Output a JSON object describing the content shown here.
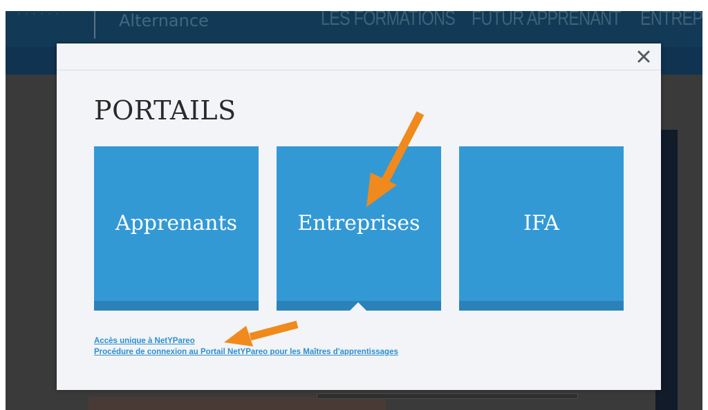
{
  "background_page": {
    "brand_small": "· · · · · ·",
    "brand": "Alternance",
    "nav": [
      "LES FORMATIONS",
      "FUTUR APPRENANT",
      "ENTREPRI"
    ]
  },
  "modal": {
    "title": "PORTAILS",
    "close_icon": "close-icon",
    "tiles": [
      {
        "label": "Apprenants"
      },
      {
        "label": "Entreprises"
      },
      {
        "label": "IFA"
      }
    ],
    "links": [
      {
        "label": "Accès unique à NetYPareo"
      },
      {
        "label": "Procédure de connexion au Portail NetYPareo pour les Maîtres d'apprentissages"
      }
    ]
  },
  "colors": {
    "tile": "#3399d5",
    "tile_bar": "#2a82b9",
    "link": "#2b8fd1",
    "arrow": "#f08a1c",
    "header": "#123a56"
  }
}
